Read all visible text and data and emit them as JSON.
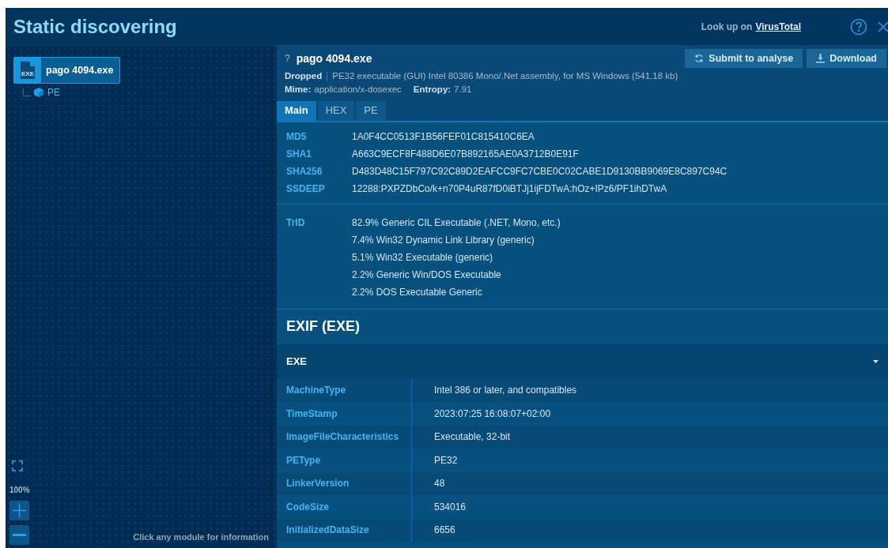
{
  "title": "Static discovering",
  "lookup": {
    "prefix": "Look up on",
    "link": "VirusTotal"
  },
  "tree": {
    "root": {
      "badge": "EXE",
      "label": "pago 4094.exe",
      "selected": true
    },
    "children": [
      {
        "label": "PE"
      }
    ]
  },
  "zoom": {
    "reading": "100%"
  },
  "hint": "Click any module for information",
  "file": {
    "mark": "?",
    "name": "pago 4094.exe",
    "status": "Dropped",
    "description": "PE32 executable (GUI) Intel 80386 Mono/.Net assembly, for MS Windows (541.18 kb)",
    "mime_label": "Mime:",
    "mime": "application/x-dosexec",
    "entropy_label": "Entropy:",
    "entropy": "7.91"
  },
  "buttons": [
    {
      "kind": "submit",
      "label": "Submit to analyse"
    },
    {
      "kind": "download",
      "label": "Download"
    }
  ],
  "tabs": [
    {
      "label": "Main",
      "selected": true
    },
    {
      "label": "HEX",
      "selected": false
    },
    {
      "label": "PE",
      "selected": false
    }
  ],
  "hashes": [
    {
      "name": "MD5",
      "value": "1A0F4CC0513F1B56FEF01C815410C6EA"
    },
    {
      "name": "SHA1",
      "value": "A663C9ECF8F488D6E07B892165AE0A3712B0E91F"
    },
    {
      "name": "SHA256",
      "value": "D483D48C15F797C92C89D2EAFCC9FC7CBE0C02CABE1D9130BB9069E8C897C94C"
    },
    {
      "name": "SSDEEP",
      "value": "12288:PXPZDbCo/k+n70P4uR87fD0iBTJj1ijFDTwA:hOz+IPz6/PF1ihDTwA"
    }
  ],
  "trid": {
    "label": "TrID",
    "lines": [
      "82.9% Generic CIL Executable (.NET, Mono, etc.)",
      "7.4% Win32 Dynamic Link Library (generic)",
      "5.1% Win32 Executable (generic)",
      "2.2% Generic Win/DOS Executable",
      "2.2% DOS Executable Generic"
    ]
  },
  "exif": {
    "title": "EXIF (EXE)",
    "group": "EXE",
    "expanded": true,
    "rows": [
      {
        "key": "MachineType",
        "value": "Intel 386 or later, and compatibles"
      },
      {
        "key": "TimeStamp",
        "value": "2023:07:25 16:08:07+02:00"
      },
      {
        "key": "ImageFileCharacteristics",
        "value": "Executable, 32-bit"
      },
      {
        "key": "PEType",
        "value": "PE32"
      },
      {
        "key": "LinkerVersion",
        "value": "48"
      },
      {
        "key": "CodeSize",
        "value": "534016"
      },
      {
        "key": "InitializedDataSize",
        "value": "6656"
      }
    ]
  }
}
